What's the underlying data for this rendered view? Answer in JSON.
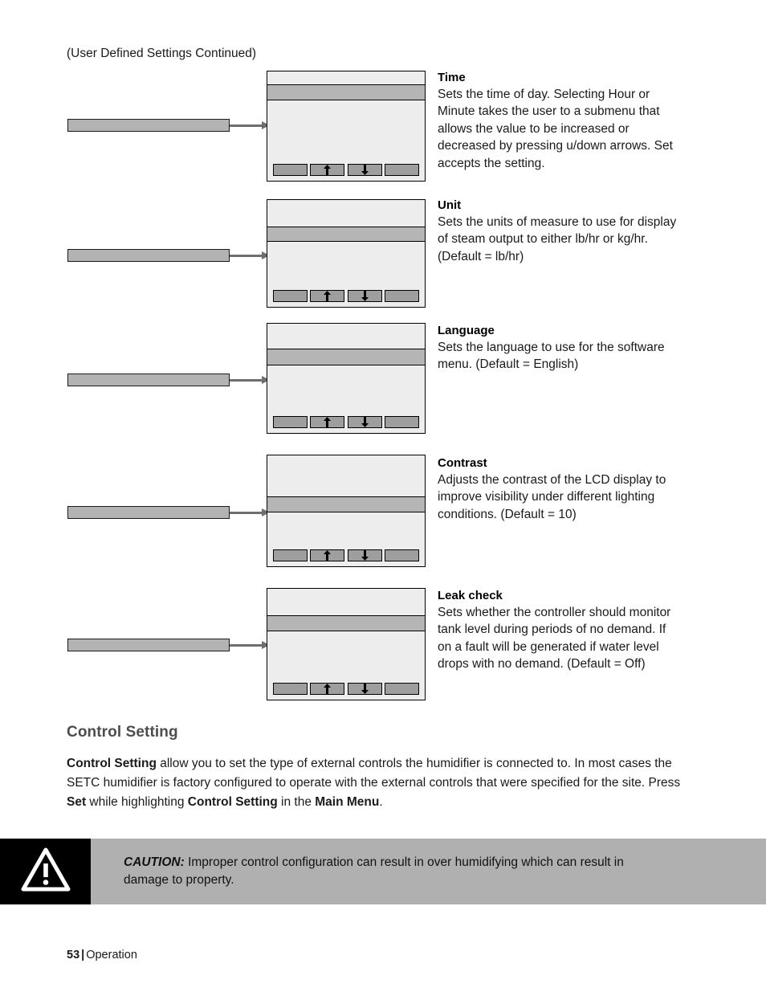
{
  "page": {
    "subtitle": "(User Defined Settings Continued)",
    "footer_page_number": "53",
    "footer_separator": "|",
    "footer_section": "Operation"
  },
  "colors": {
    "lcd_background": "#ededed",
    "lcd_highlight": "#b5b5b5",
    "callout_fill": "#b3b3b3",
    "softkey_fill": "#9e9e9e",
    "connector": "#6e6e6e",
    "caution_banner": "#b0b0b0",
    "caution_icon_box": "#000000",
    "heading_gray": "#4d4d4d"
  },
  "softkeys": {
    "key1_icon": "blank-softkey-icon",
    "key2_icon": "up-arrow-icon",
    "key3_icon": "down-arrow-icon",
    "key4_icon": "blank-softkey-icon"
  },
  "entries": [
    {
      "title": "Time",
      "body": "Sets the time of day.  Selecting Hour or Minute takes the user to a submenu that allows the value to be increased or decreased by pressing u/down arrows.  Set accepts the setting.",
      "callout_label": ""
    },
    {
      "title": "Unit",
      "body": "Sets the units of measure to use for display of steam output to either lb/hr or kg/hr.  (Default = lb/hr)",
      "callout_label": ""
    },
    {
      "title": "Language",
      "body": "Sets the language to use for the software menu.  (Default = English)",
      "callout_label": ""
    },
    {
      "title": "Contrast",
      "body": "Adjusts the contrast of the LCD display to improve visibility under different lighting conditions. (Default = 10)",
      "callout_label": ""
    },
    {
      "title": "Leak check",
      "body": "Sets whether the controller should monitor tank level during periods of no demand.  If on a fault will be generated if water level drops with no demand.  (Default = Off)",
      "callout_label": ""
    }
  ],
  "control_setting": {
    "heading": "Control Setting",
    "para_part1_bold": "Control Setting",
    "para_part2": " allow you to set the type of external controls the humidifier is connected to.  In most cases the SETC humidifier is factory configured to operate with the external controls that were specified for the site.  Press ",
    "para_part3_bold": "Set",
    "para_part4": " while highlighting ",
    "para_part5_bold": "Control Setting",
    "para_part6": " in the ",
    "para_part7_bold": "Main Menu",
    "para_part8": "."
  },
  "caution": {
    "label": "CAUTION:",
    "text": " Improper control configuration can result in over humidifying which can result in damage to property.",
    "icon": "warning-triangle-icon"
  }
}
